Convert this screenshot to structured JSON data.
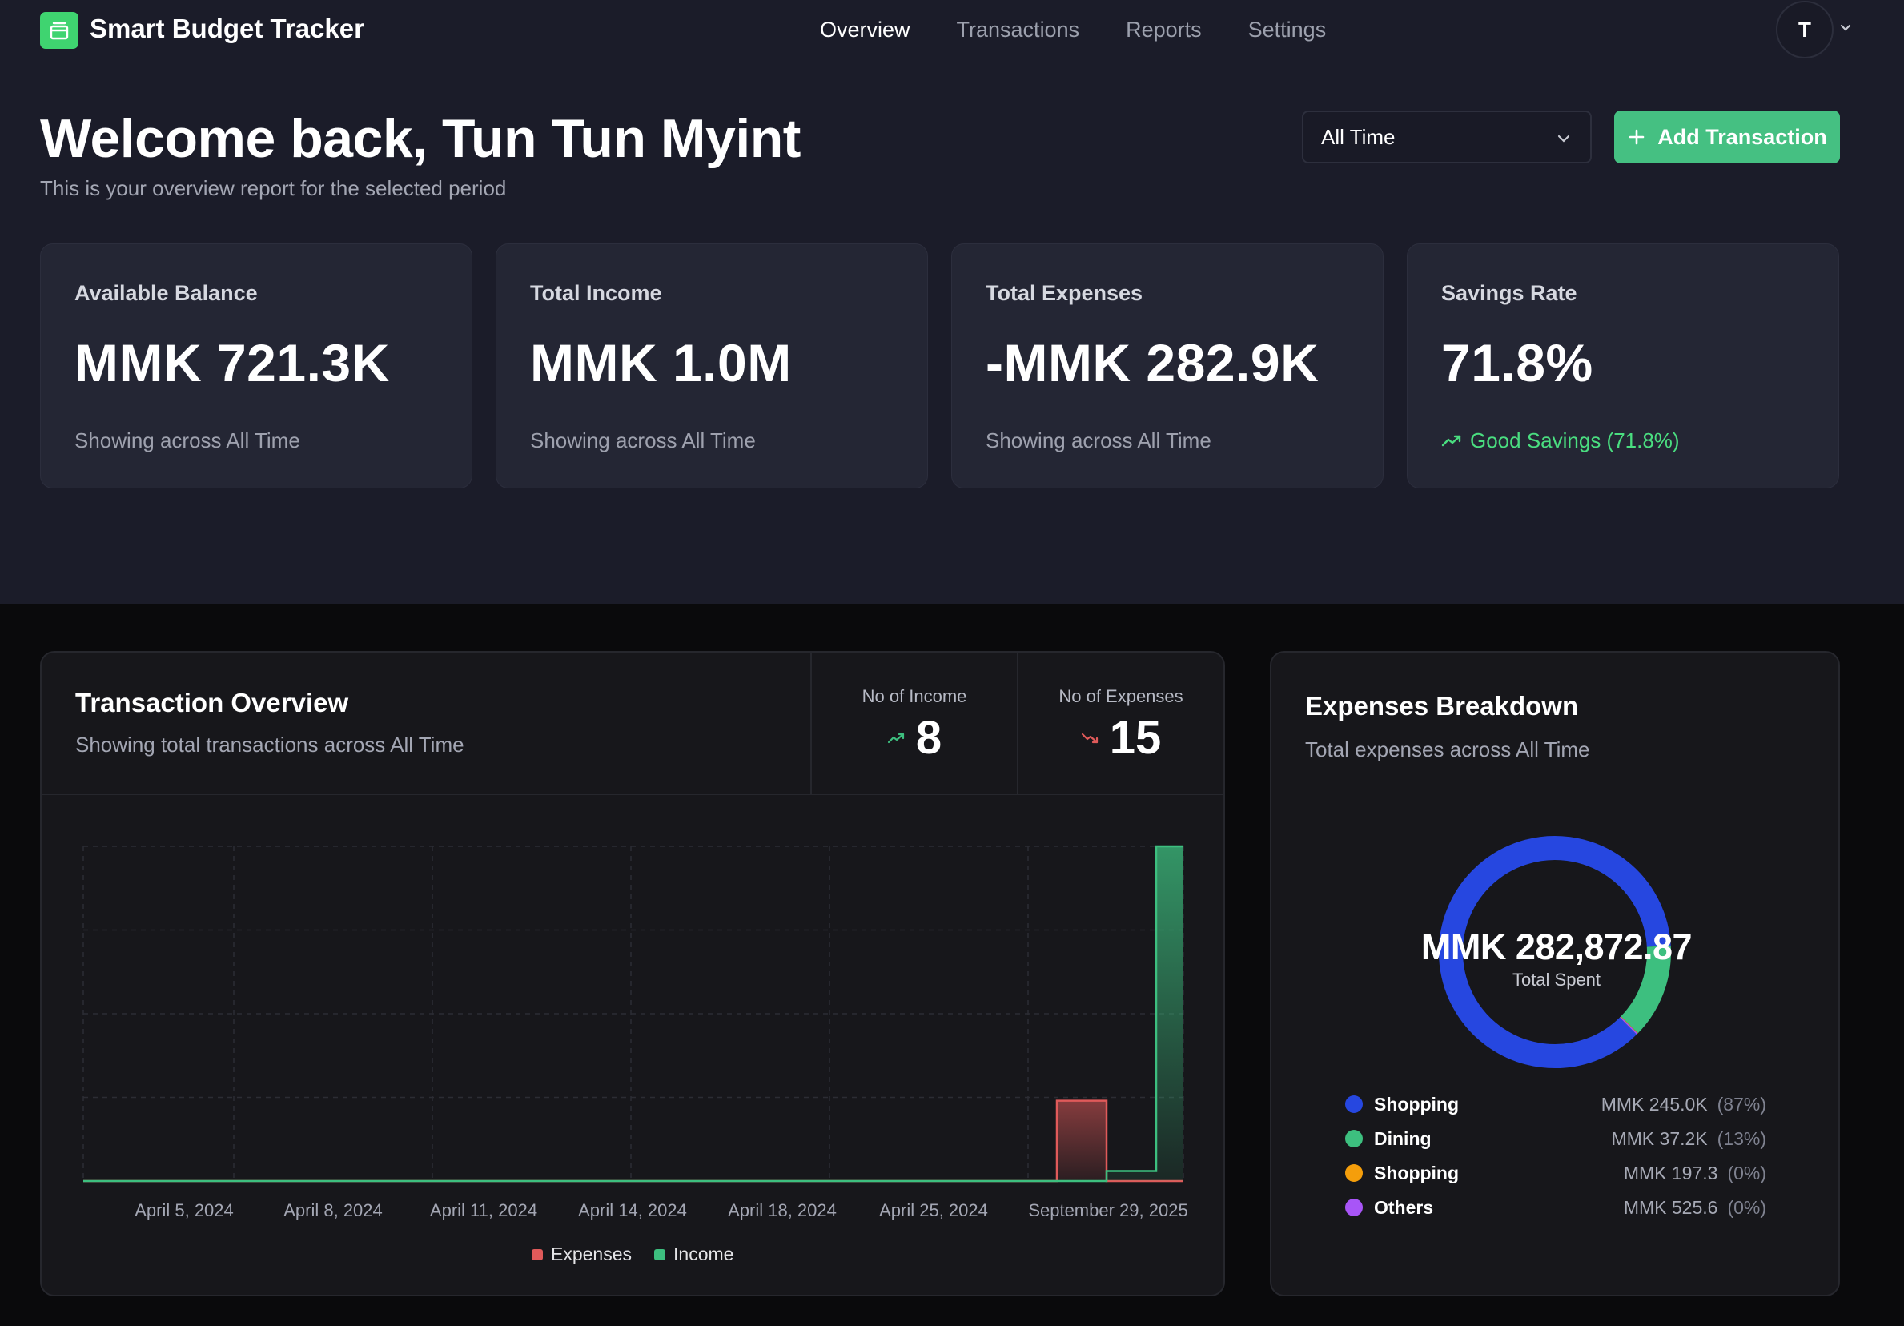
{
  "app": {
    "name": "Smart Budget Tracker",
    "user_initial": "T"
  },
  "nav": {
    "items": [
      {
        "label": "Overview",
        "active": true
      },
      {
        "label": "Transactions",
        "active": false
      },
      {
        "label": "Reports",
        "active": false
      },
      {
        "label": "Settings",
        "active": false
      }
    ]
  },
  "header": {
    "title": "Welcome back, Tun Tun Myint",
    "subtitle": "This is your overview report for the selected period",
    "period_value": "All Time",
    "add_label": "Add Transaction"
  },
  "stats": [
    {
      "label": "Available Balance",
      "value": "MMK 721.3K",
      "foot": "Showing across All Time"
    },
    {
      "label": "Total Income",
      "value": "MMK 1.0M",
      "foot": "Showing across All Time"
    },
    {
      "label": "Total Expenses",
      "value": "-MMK 282.9K",
      "foot": "Showing across All Time"
    },
    {
      "label": "Savings Rate",
      "value": "71.8%",
      "foot": "Good Savings (71.8%)"
    }
  ],
  "transaction_overview": {
    "title": "Transaction Overview",
    "subtitle": "Showing total transactions across All Time",
    "income_count_label": "No of Income",
    "income_count": "8",
    "expense_count_label": "No of Expenses",
    "expense_count": "15"
  },
  "expenses_breakdown": {
    "title": "Expenses Breakdown",
    "subtitle": "Total expenses across All Time",
    "total": "MMK 282,872.87",
    "total_caption": "Total Spent",
    "items": [
      {
        "name": "Shopping",
        "amount": "MMK 245.0K",
        "pct": "(87%)",
        "color": "#2647e0",
        "share": 0.866
      },
      {
        "name": "Dining",
        "amount": "MMK 37.2K",
        "pct": "(13%)",
        "color": "#3dbf7f",
        "share": 0.132
      },
      {
        "name": "Shopping",
        "amount": "MMK 197.3",
        "pct": "(0%)",
        "color": "#f59e0b",
        "share": 0.0007
      },
      {
        "name": "Others",
        "amount": "MMK 525.6",
        "pct": "(0%)",
        "color": "#a855f7",
        "share": 0.0019
      }
    ]
  },
  "colors": {
    "income": "#3dbf7f",
    "expense": "#e05a5a",
    "accent": "#45c082",
    "good": "#4ade80"
  },
  "chart_data": {
    "type": "area",
    "categories": [
      "April 5, 2024",
      "April 8, 2024",
      "April 11, 2024",
      "April 14, 2024",
      "April 18, 2024",
      "April 25, 2024",
      "September 29, 2025"
    ],
    "ylim": [
      0,
      1
    ],
    "series": [
      {
        "name": "Expenses",
        "color": "#e05a5a",
        "values": [
          0,
          0,
          0,
          0,
          0,
          0,
          0.24,
          0
        ]
      },
      {
        "name": "Income",
        "color": "#3dbf7f",
        "values": [
          0,
          0,
          0,
          0,
          0,
          0,
          0.03,
          1
        ]
      }
    ],
    "grid": true,
    "legend": "bottom-center"
  }
}
